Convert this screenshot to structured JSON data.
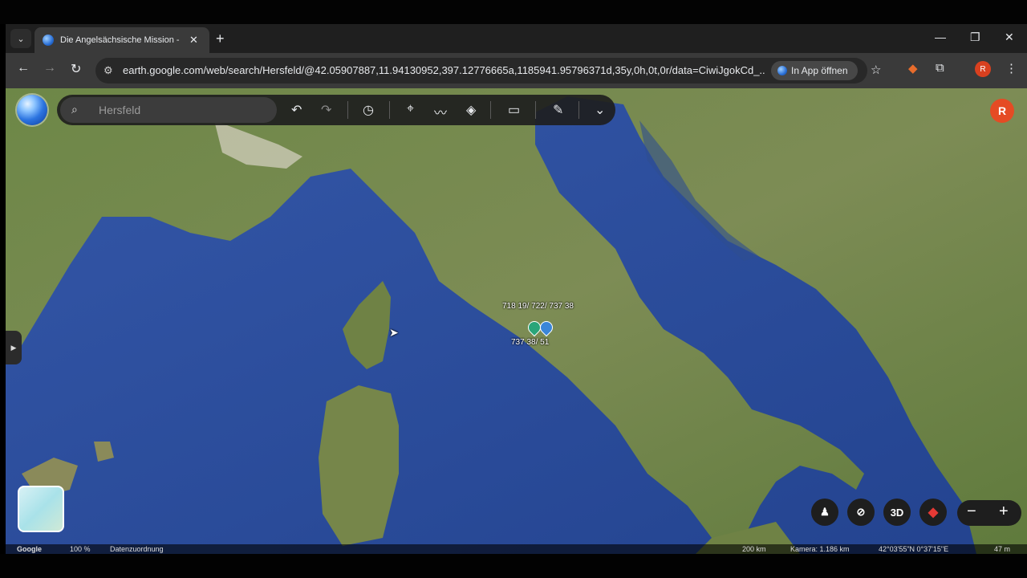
{
  "tab": {
    "title": "Die Angelsächsische Mission - ",
    "close": "✕"
  },
  "tabstrip": {
    "new_tab": "+",
    "menu": "⌄",
    "minimize": "—",
    "restore": "❐",
    "close": "✕"
  },
  "toolbar": {
    "back": "←",
    "forward": "→",
    "reload": "↻",
    "url": "earth.google.com/web/search/Hersfeld/@42.05907887,11.94130952,397.12776665a,1185941.95796371d,35y,0h,0t,0r/data=CiwiJgokCd_...",
    "open_in_app": "In App öffnen",
    "star": "☆",
    "profile_initial": "R"
  },
  "earth_toolbar": {
    "search_value": "Hersfeld",
    "undo": "↶",
    "redo": "↷"
  },
  "account_initial": "R",
  "map": {
    "labels": {
      "top": "718 19/ 722/ 737 38",
      "bottom": "737 38/ 51"
    },
    "controls": {
      "three_d": "3D",
      "zoom_out": "−",
      "zoom_in": "+"
    },
    "pin_colors": [
      "#2aa579",
      "#3b86d8"
    ]
  },
  "status": {
    "google": "Google",
    "zoom": "100 %",
    "data_attribution": "Datenzuordnung",
    "scale": "200 km",
    "camera": "Kamera: 1.186 km",
    "coords": "42°03'55\"N 0°37'15\"E",
    "elevation": "47 m"
  },
  "colors": {
    "sea": "#2f4f9a",
    "land": "#5d7a3e",
    "account": "#e54b24"
  }
}
